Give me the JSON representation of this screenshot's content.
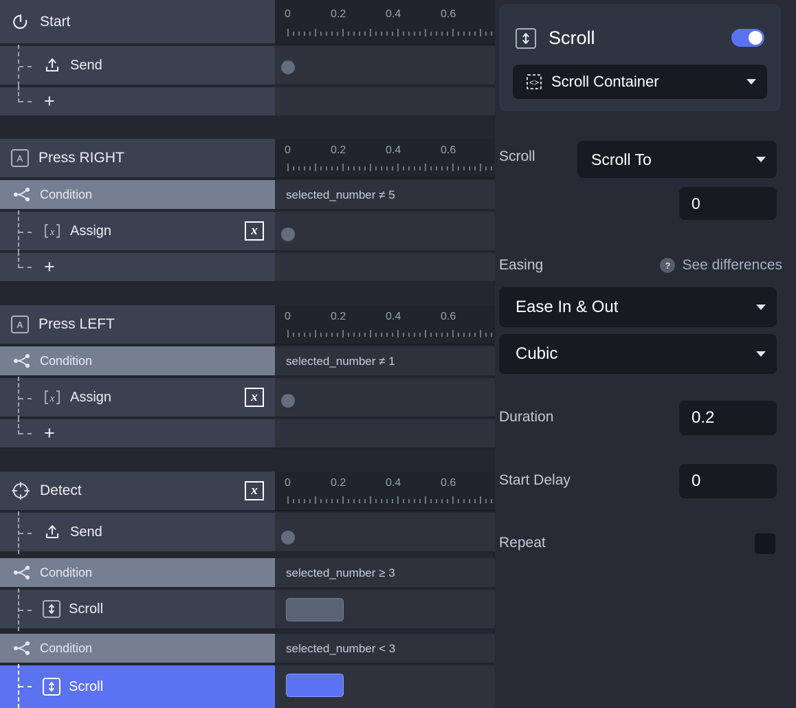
{
  "timeline_ruler": {
    "ticks": [
      "0",
      "0.2",
      "0.4",
      "0.6"
    ]
  },
  "tree": {
    "groups": [
      {
        "header": {
          "label": "Start",
          "icon": "power-icon",
          "badge": null
        },
        "rows": [
          {
            "label": "Send",
            "icon": "send-icon",
            "type": "action",
            "badge": null,
            "expr": null,
            "keyframe": "dot"
          },
          {
            "label": "+",
            "icon": "plus-icon",
            "type": "add",
            "badge": null,
            "expr": null,
            "keyframe": null
          }
        ]
      },
      {
        "header": {
          "label": "Press RIGHT",
          "icon": "keyboard-key-icon",
          "badge": null
        },
        "rows": [
          {
            "label": "Condition",
            "icon": "branch-icon",
            "type": "condition",
            "badge": null,
            "expr": "selected_number ≠ 5",
            "keyframe": null
          },
          {
            "label": "Assign",
            "icon": "variable-icon",
            "type": "action",
            "badge": "x",
            "expr": null,
            "keyframe": "dot"
          },
          {
            "label": "+",
            "icon": "plus-icon",
            "type": "add",
            "badge": null,
            "expr": null,
            "keyframe": null
          }
        ]
      },
      {
        "header": {
          "label": "Press LEFT",
          "icon": "keyboard-key-icon",
          "badge": null
        },
        "rows": [
          {
            "label": "Condition",
            "icon": "branch-icon",
            "type": "condition",
            "badge": null,
            "expr": "selected_number ≠ 1",
            "keyframe": null
          },
          {
            "label": "Assign",
            "icon": "variable-icon",
            "type": "action",
            "badge": "x",
            "expr": null,
            "keyframe": "dot"
          },
          {
            "label": "+",
            "icon": "plus-icon",
            "type": "add",
            "badge": null,
            "expr": null,
            "keyframe": null
          }
        ]
      },
      {
        "header": {
          "label": "Detect",
          "icon": "detect-target-icon",
          "badge": "x"
        },
        "rows": [
          {
            "label": "Send",
            "icon": "send-icon",
            "type": "action",
            "badge": null,
            "expr": null,
            "keyframe": "dot"
          },
          {
            "label": "Condition",
            "icon": "branch-icon",
            "type": "condition",
            "badge": null,
            "expr": "selected_number ≥ 3",
            "keyframe": null
          },
          {
            "label": "Scroll",
            "icon": "scroll-icon",
            "type": "action",
            "badge": null,
            "expr": null,
            "keyframe": "bar"
          },
          {
            "label": "Condition",
            "icon": "branch-icon",
            "type": "condition",
            "badge": null,
            "expr": "selected_number < 3",
            "keyframe": null
          },
          {
            "label": "Scroll",
            "icon": "scroll-icon",
            "type": "action",
            "badge": null,
            "expr": null,
            "keyframe": "bar-selected",
            "selected": true
          }
        ]
      }
    ]
  },
  "inspector": {
    "card": {
      "title": "Scroll",
      "icon": "scroll-icon",
      "enabled": true,
      "target": {
        "label": "Scroll Container",
        "icon": "component-icon"
      }
    },
    "properties": {
      "scroll_label": "Scroll",
      "scroll_mode": "Scroll To",
      "scroll_value": "0",
      "easing_label": "Easing",
      "see_differences": "See differences",
      "easing_type": "Ease In & Out",
      "easing_curve": "Cubic",
      "duration_label": "Duration",
      "duration_value": "0.2",
      "start_delay_label": "Start Delay",
      "start_delay_value": "0",
      "repeat_label": "Repeat",
      "repeat_checked": false
    }
  },
  "colors": {
    "accent": "#5b73f0",
    "row_bg": "#3b4150",
    "row_selected_gray": "#767f92",
    "panel_bg": "#272b35",
    "timeline_bg": "#2d323d",
    "field_bg": "#171a21"
  }
}
